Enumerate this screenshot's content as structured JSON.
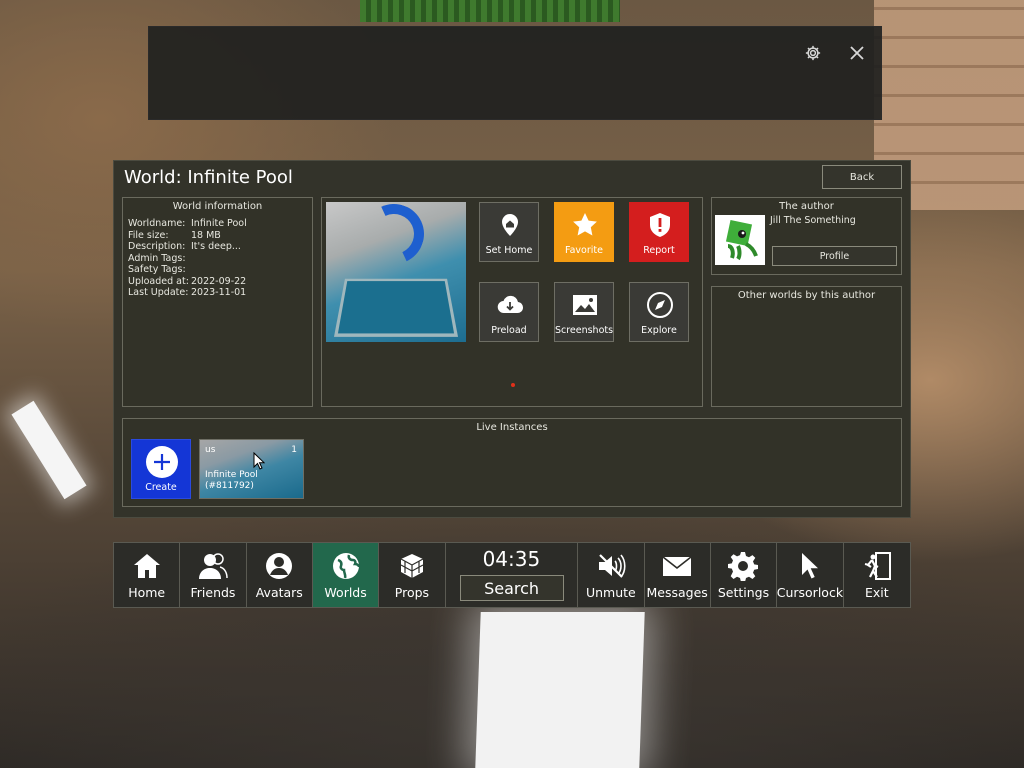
{
  "top_bar": {
    "settings_icon": "gear-icon",
    "close_icon": "close-icon"
  },
  "panel": {
    "title": "World: Infinite Pool",
    "back_label": "Back",
    "world_info": {
      "title": "World information",
      "rows": [
        {
          "label": "Worldname:",
          "value": "Infinite Pool"
        },
        {
          "label": "File size:",
          "value": "18 MB"
        },
        {
          "label": "Description:",
          "value": "It's deep..."
        },
        {
          "label": "Admin Tags:",
          "value": ""
        },
        {
          "label": "Safety Tags:",
          "value": ""
        },
        {
          "label": "Uploaded at:",
          "value": "2022-09-22"
        },
        {
          "label": "Last Update:",
          "value": "2023-11-01"
        }
      ]
    },
    "actions": [
      {
        "label": "Set Home",
        "icon": "home-pin-icon"
      },
      {
        "label": "Favorite",
        "icon": "star-icon",
        "color": "#f49c12"
      },
      {
        "label": "Report",
        "icon": "warning-shield-icon",
        "color": "#d41e1e"
      },
      {
        "label": "Preload",
        "icon": "cloud-download-icon"
      },
      {
        "label": "Screenshots",
        "icon": "image-icon"
      },
      {
        "label": "Explore",
        "icon": "compass-icon"
      }
    ],
    "author": {
      "title": "The author",
      "name": "Jill The Something",
      "profile_label": "Profile"
    },
    "other_worlds_title": "Other worlds by this author",
    "instances": {
      "title": "Live Instances",
      "create_label": "Create",
      "items": [
        {
          "region": "us",
          "count": "1",
          "name": "Infinite Pool",
          "id": "(#811792)"
        }
      ]
    }
  },
  "bottom_bar": {
    "clock": "04:35",
    "search_label": "Search",
    "active": "Worlds",
    "items": [
      {
        "label": "Home",
        "icon": "home-icon"
      },
      {
        "label": "Friends",
        "icon": "friends-icon"
      },
      {
        "label": "Avatars",
        "icon": "avatar-icon"
      },
      {
        "label": "Worlds",
        "icon": "globe-icon"
      },
      {
        "label": "Props",
        "icon": "cube-icon"
      },
      {
        "label": "Unmute",
        "icon": "speaker-muted-icon"
      },
      {
        "label": "Messages",
        "icon": "envelope-icon"
      },
      {
        "label": "Settings",
        "icon": "gear-icon"
      },
      {
        "label": "Cursorlock",
        "icon": "cursor-icon"
      },
      {
        "label": "Exit",
        "icon": "exit-icon"
      }
    ]
  },
  "colors": {
    "active_nav": "#22684c",
    "favorite": "#f49c12",
    "report": "#d41e1e",
    "create": "#1436d6"
  }
}
